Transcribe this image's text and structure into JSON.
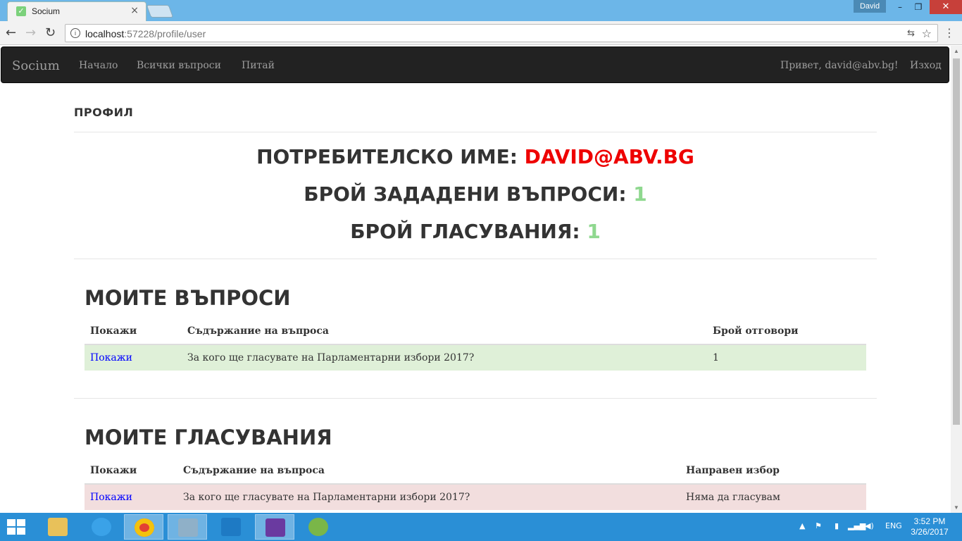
{
  "browser": {
    "tab_title": "Socium",
    "tab_close": "×",
    "profile": "David",
    "window_controls": {
      "minimize": "–",
      "restore": "❐",
      "close": "✕"
    },
    "url_host": "localhost",
    "url_path": ":57228/profile/user",
    "back": "←",
    "forward": "→",
    "reload": "↻",
    "star": "☆",
    "menu": "⋮",
    "translate": "⇆"
  },
  "site": {
    "brand": "Socium",
    "nav": {
      "home": "Начало",
      "all_questions": "Всички въпроси",
      "ask": "Питай"
    },
    "greeting": "Привет, david@abv.bg!",
    "logout": "Изход"
  },
  "profile": {
    "title": "ПРОФИЛ",
    "username_label": "ПОТРЕБИТЕЛСКО ИМЕ: ",
    "username": "DAVID@ABV.BG",
    "questions_label": "БРОЙ ЗАДАДЕНИ ВЪПРОСИ: ",
    "questions_count": "1",
    "votes_label": "БРОЙ ГЛАСУВАНИЯ: ",
    "votes_count": "1"
  },
  "my_questions": {
    "title": "МОИТЕ ВЪПРОСИ",
    "headers": [
      "Покажи",
      "Съдържание на въпроса",
      "Брой отговори"
    ],
    "rows": [
      {
        "link": "Покажи",
        "content": "За кого ще гласувате на Парламентарни избори 2017?",
        "answers": "1"
      }
    ]
  },
  "my_votes": {
    "title": "МОИТЕ ГЛАСУВАНИЯ",
    "headers": [
      "Покажи",
      "Съдържание на въпроса",
      "Направен избор"
    ],
    "rows": [
      {
        "link": "Покажи",
        "content": "За кого ще гласувате на Парламентарни избори 2017?",
        "choice": "Няма да гласувам"
      }
    ]
  },
  "taskbar": {
    "language": "ENG",
    "time": "3:52 PM",
    "date": "3/26/2017",
    "colors": {
      "accent": "#2a8fd6",
      "success_row": "#dff0d8",
      "danger_row": "#f2dede",
      "username": "#ee0000",
      "count": "#8fd88f"
    },
    "apps": [
      "file-explorer-icon",
      "internet-explorer-icon",
      "chrome-icon",
      "snipping-tool-icon",
      "vs-code-icon",
      "visual-studio-icon",
      "android-studio-icon"
    ]
  }
}
